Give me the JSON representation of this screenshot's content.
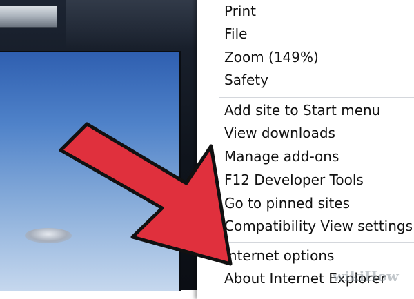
{
  "menu": {
    "items": [
      {
        "label": "Print"
      },
      {
        "label": "File"
      },
      {
        "label": "Zoom (149%)"
      },
      {
        "label": "Safety"
      },
      {
        "label": "Add site to Start menu"
      },
      {
        "label": "View downloads"
      },
      {
        "label": "Manage add-ons"
      },
      {
        "label": "F12 Developer Tools"
      },
      {
        "label": "Go to pinned sites"
      },
      {
        "label": "Compatibility View settings"
      },
      {
        "label": "Internet options"
      },
      {
        "label": "About Internet Explorer"
      }
    ]
  },
  "overlay": {
    "arrow_color": "#e0303d",
    "arrow_outline_color": "#111111"
  },
  "watermark": {
    "text": "wikiHow"
  }
}
